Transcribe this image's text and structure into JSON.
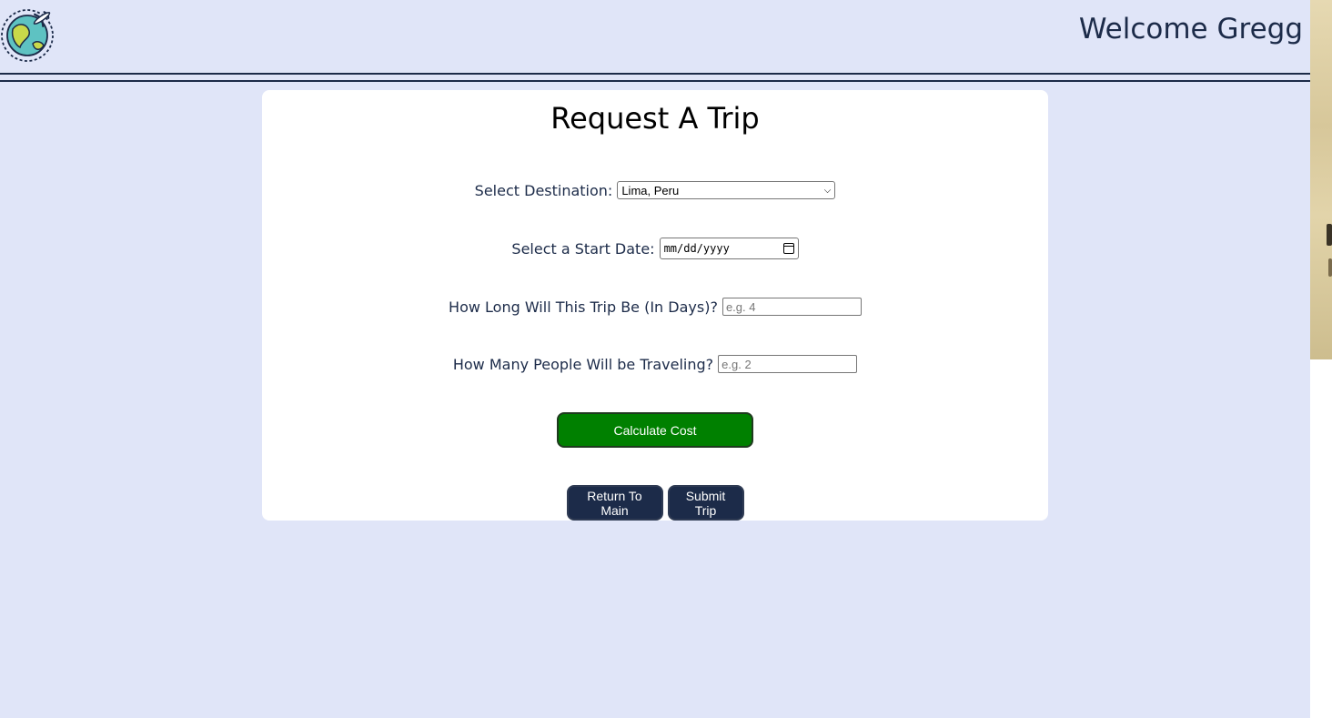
{
  "header": {
    "welcome_text": "Welcome Gregg",
    "logo_icon": "globe-plane-icon"
  },
  "form": {
    "title": "Request A Trip",
    "destination": {
      "label": "Select Destination:",
      "value": "Lima, Peru"
    },
    "start_date": {
      "label": "Select a Start Date:",
      "value": "mm/dd/yyyy"
    },
    "duration": {
      "label": "How Long Will This Trip Be (In Days)?",
      "placeholder": "e.g. 4"
    },
    "travelers": {
      "label": "How Many People Will be Traveling?",
      "placeholder": "e.g. 2"
    },
    "calculate_label": "Calculate Cost",
    "return_label": "Return To Main",
    "submit_label": "Submit Trip"
  },
  "colors": {
    "background": "#e0e5f8",
    "text": "#1c2b49",
    "calculate_button": "#008000",
    "nav_button": "#1c2b49"
  }
}
